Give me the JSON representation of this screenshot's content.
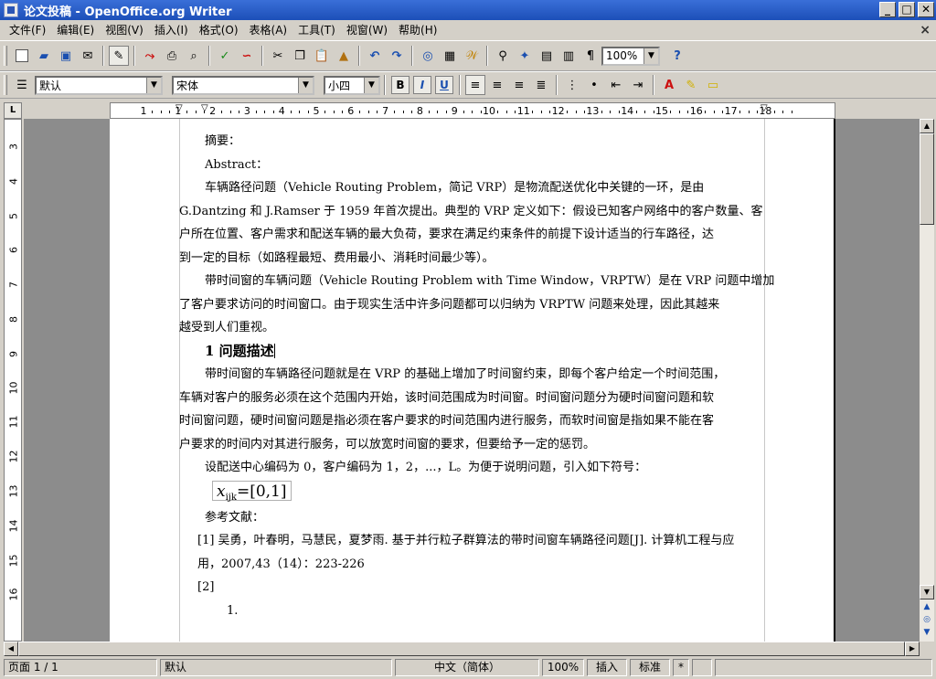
{
  "window": {
    "title": "论文投稿 - OpenOffice.org Writer",
    "min": "_",
    "max": "□",
    "close": "✕"
  },
  "menu": [
    "文件(F)",
    "编辑(E)",
    "视图(V)",
    "插入(I)",
    "格式(O)",
    "表格(A)",
    "工具(T)",
    "视窗(W)",
    "帮助(H)"
  ],
  "doc_close": "×",
  "toolbar": {
    "zoom_value": "100%"
  },
  "format_bar": {
    "style": "默认",
    "font": "宋体",
    "size": "小四",
    "bold": "B",
    "italic": "I",
    "underline": "U"
  },
  "ruler": {
    "corner": "L",
    "h_numbers": [
      "1",
      "1",
      "2",
      "3",
      "4",
      "5",
      "6",
      "7",
      "8",
      "9",
      "10",
      "11",
      "12",
      "13",
      "14",
      "15",
      "16",
      "17",
      "18"
    ],
    "v_numbers": [
      "3",
      "4",
      "5",
      "6",
      "7",
      "8",
      "9",
      "10",
      "11",
      "12",
      "13",
      "14",
      "15",
      "16"
    ]
  },
  "document": {
    "lines": [
      {
        "type": "indent",
        "text": "摘要："
      },
      {
        "type": "indent",
        "text": "Abstract："
      },
      {
        "type": "indent",
        "text": "车辆路径问题（Vehicle Routing Problem，简记 VRP）是物流配送优化中关键的一环，是由"
      },
      {
        "type": "plain",
        "text": "G.Dantzing 和 J.Ramser 于 1959 年首次提出。典型的 VRP 定义如下：假设已知客户网络中的客户数量、客"
      },
      {
        "type": "plain",
        "text": "户所在位置、客户需求和配送车辆的最大负荷，要求在满足约束条件的前提下设计适当的行车路径，达"
      },
      {
        "type": "plain",
        "text": "到一定的目标（如路程最短、费用最小、消耗时间最少等）。"
      },
      {
        "type": "indent",
        "text": "带时间窗的车辆问题（Vehicle Routing Problem with Time Window，VRPTW）是在 VRP 问题中增加"
      },
      {
        "type": "plain",
        "text": "了客户要求访问的时间窗口。由于现实生活中许多问题都可以归纳为 VRPTW 问题来处理，因此其越来"
      },
      {
        "type": "plain",
        "text": "越受到人们重视。"
      },
      {
        "type": "heading",
        "text": "1 问题描述"
      },
      {
        "type": "indent",
        "text": "带时间窗的车辆路径问题就是在 VRP 的基础上增加了时间窗约束，即每个客户给定一个时间范围，"
      },
      {
        "type": "plain",
        "text": "车辆对客户的服务必须在这个范围内开始，该时间范围成为时间窗。时间窗问题分为硬时间窗问题和软"
      },
      {
        "type": "plain",
        "text": "时间窗问题，硬时间窗问题是指必须在客户要求的时间范围内进行服务，而软时间窗是指如果不能在客"
      },
      {
        "type": "plain",
        "text": "户要求的时间内对其进行服务，可以放宽时间窗的要求，但要给予一定的惩罚。"
      },
      {
        "type": "indent",
        "text": "设配送中心编码为 0，客户编码为 1，2，...，L。为便于说明问题，引入如下符号："
      }
    ],
    "formula": {
      "var": "x",
      "sub": "ijk",
      "rest": "=[0,1]"
    },
    "refs_title": "参考文献：",
    "ref1_line1": "[1] 吴勇，叶春明，马慧民，夏梦雨. 基于并行粒子群算法的带时间窗车辆路径问题[J]. 计算机工程与应",
    "ref1_line2": "用，2007,43（14）：223-226",
    "ref2": "[2]",
    "item1": "1."
  },
  "status": {
    "page": "页面 1 / 1",
    "style": "默认",
    "language": "中文（简体）",
    "zoom": "100%",
    "insert_mode": "插入",
    "selection_mode": "标准",
    "modified": "*"
  }
}
